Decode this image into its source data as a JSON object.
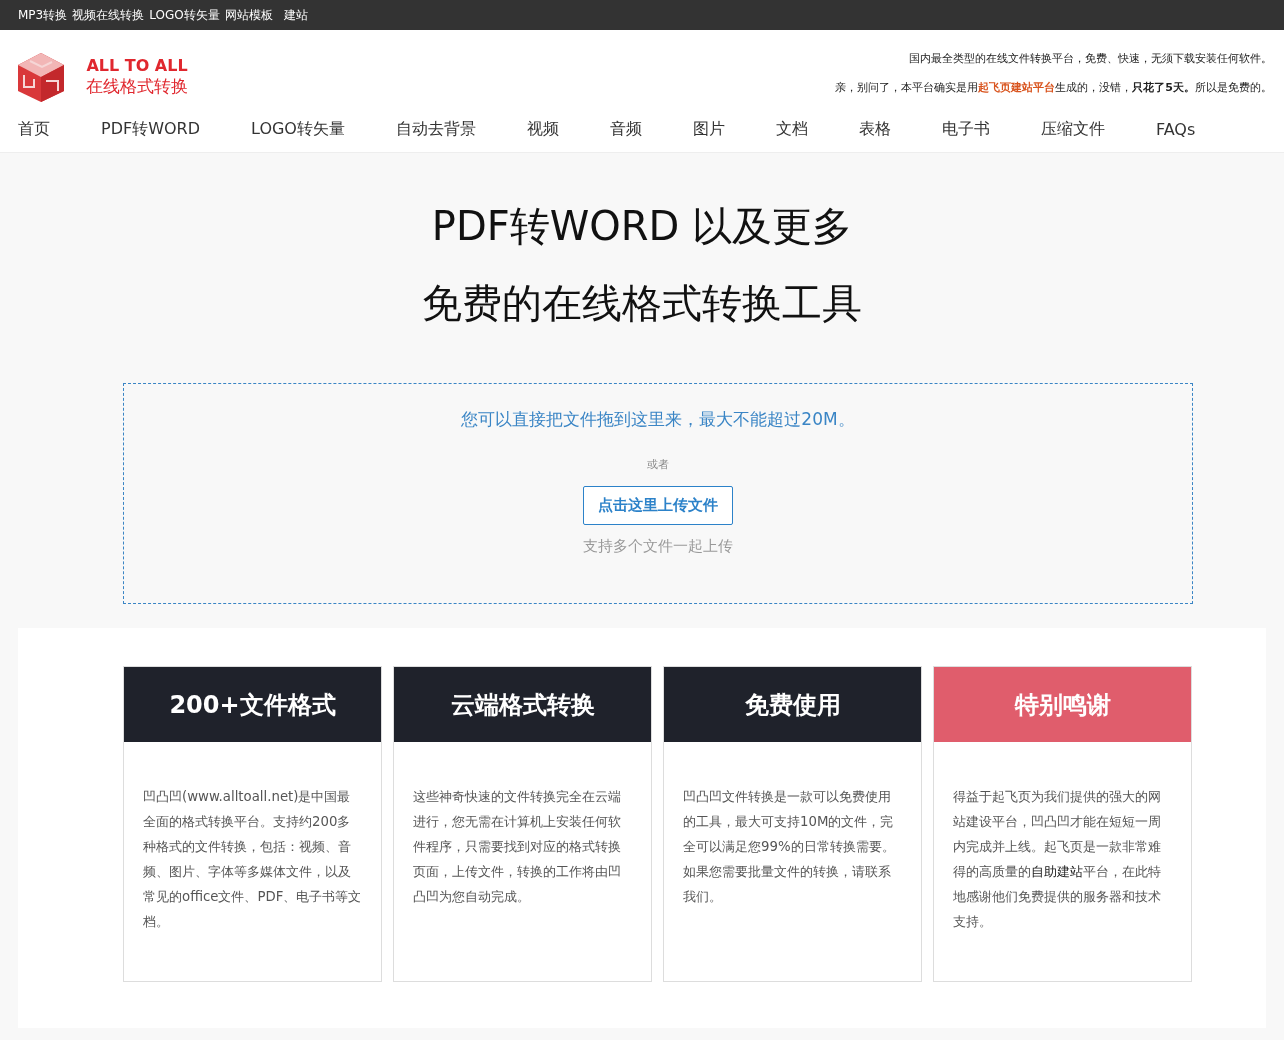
{
  "top_bar": {
    "links": [
      "MP3转换",
      "视频在线转换",
      "LOGO转矢量",
      "网站模板",
      "建站"
    ]
  },
  "header": {
    "logo": {
      "line_1": "ALL TO ALL",
      "line_2": "在线格式转换"
    },
    "tagline": "国内最全类型的在线文件转换平台，免费、快速，无须下载安装任何软件。",
    "notice": [
      {
        "kind": "text",
        "text": "亲，别问了，本平台确实是用"
      },
      {
        "kind": "link",
        "text": "起飞页建站平台"
      },
      {
        "kind": "text",
        "text": "生成的，没错，"
      },
      {
        "kind": "bold",
        "text": "只花了5天。"
      },
      {
        "kind": "text",
        "text": "所以是免费的。"
      }
    ]
  },
  "nav": [
    "首页",
    "PDF转WORD",
    "LOGO转矢量",
    "自动去背景",
    "视频",
    "音频",
    "图片",
    "文档",
    "表格",
    "电子书",
    "压缩文件",
    "FAQs"
  ],
  "hero": {
    "title_line_1": "PDF转WORD 以及更多",
    "title_line_2": "免费的在线格式转换工具"
  },
  "upload": {
    "hint": "您可以直接把文件拖到这里来，最大不能超过20M。",
    "or": "或者",
    "button": "点击这里上传文件",
    "note": "支持多个文件一起上传"
  },
  "features": [
    {
      "title": "200+文件格式",
      "color": "#1f222b",
      "body": [
        {
          "kind": "text",
          "text": "凹凸凹(www.alltoall.net)是中国最全面的格式转换平台。支持约200多种格式的文件转换，包括：视频、音频、图片、字体等多媒体文件，以及常见的office文件、PDF、电子书等文档。"
        }
      ]
    },
    {
      "title": "云端格式转换",
      "color": "#1f222b",
      "body": [
        {
          "kind": "text",
          "text": "这些神奇快速的文件转换完全在云端进行，您无需在计算机上安装任何软件程序，只需要找到对应的格式转换页面，上传文件，转换的工作将由凹凸凹为您自动完成。"
        }
      ]
    },
    {
      "title": "免费使用",
      "color": "#1f222b",
      "body": [
        {
          "kind": "text",
          "text": "凹凸凹文件转换是一款可以免费使用的工具，最大可支持10M的文件，完全可以满足您99%的日常转换需要。如果您需要批量文件的转换，请联系我们。"
        }
      ]
    },
    {
      "title": "特别鸣谢",
      "color": "#e05d6c",
      "body": [
        {
          "kind": "text",
          "text": "得益于起飞页为我们提供的强大的网站建设平台，凹凸凹才能在短短一周内完成并上线。起飞页是一款非常难得的高质量的"
        },
        {
          "kind": "link",
          "text": "自助建站"
        },
        {
          "kind": "text",
          "text": "平台，在此特地感谢他们免费提供的服务器和技术支持。"
        }
      ]
    }
  ]
}
